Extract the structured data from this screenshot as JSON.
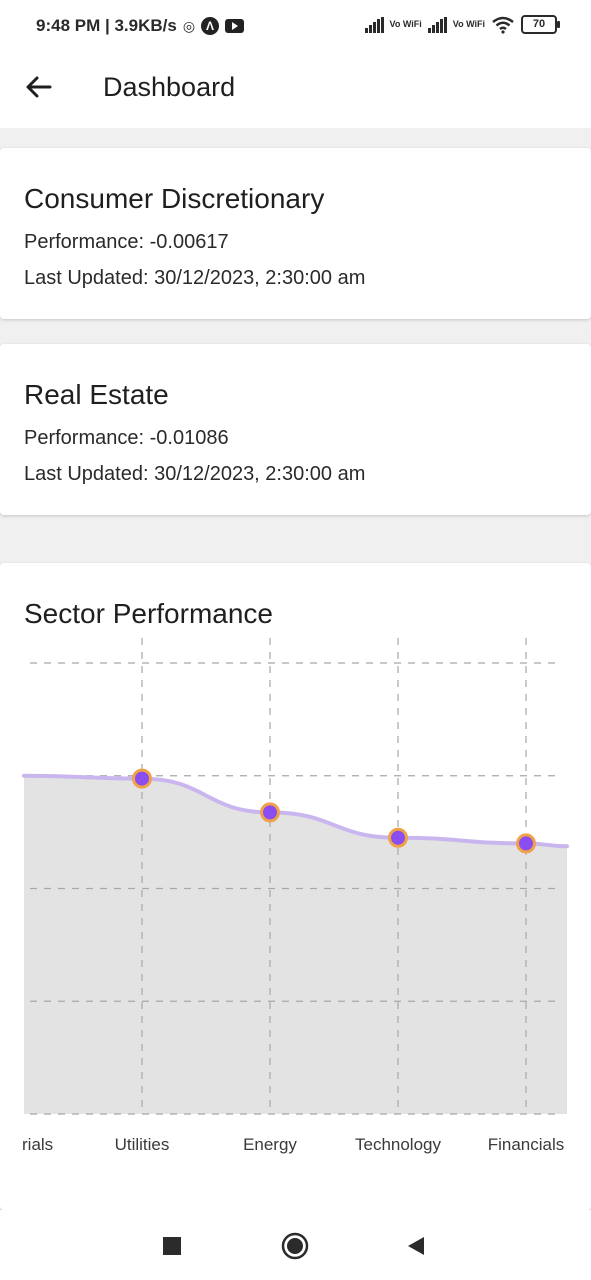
{
  "status_bar": {
    "time": "9:48 PM | 3.9KB/s",
    "vowifi_1": "Vo WiFi",
    "vowifi_2": "Vo WiFi",
    "battery": "70"
  },
  "app_bar": {
    "title": "Dashboard",
    "back_icon": "arrow-left-icon"
  },
  "cards": [
    {
      "title": "Consumer Discretionary",
      "performance": "Performance: -0.00617",
      "updated": "Last Updated: 30/12/2023, 2:30:00 am"
    },
    {
      "title": "Real Estate",
      "performance": "Performance: -0.01086",
      "updated": "Last Updated: 30/12/2023, 2:30:00 am"
    }
  ],
  "chart": {
    "title": "Sector Performance"
  },
  "chart_data": {
    "type": "area",
    "categories": [
      "rials",
      "Utilities",
      "Energy",
      "Technology",
      "Financials"
    ],
    "values": [
      0.0,
      -0.001,
      -0.013,
      -0.022,
      -0.024
    ],
    "ylim": [
      -0.12,
      0.04
    ],
    "grid": true,
    "colors": {
      "area_fill": "#e3e3e3",
      "line": "#c9b6ee",
      "point_fill": "#8a4df0",
      "point_stroke": "#f0a24a",
      "grid": "#a8a8a8"
    }
  },
  "nav_bar": {
    "items": [
      "stop-square-icon",
      "home-circle-icon",
      "back-triangle-icon"
    ]
  }
}
